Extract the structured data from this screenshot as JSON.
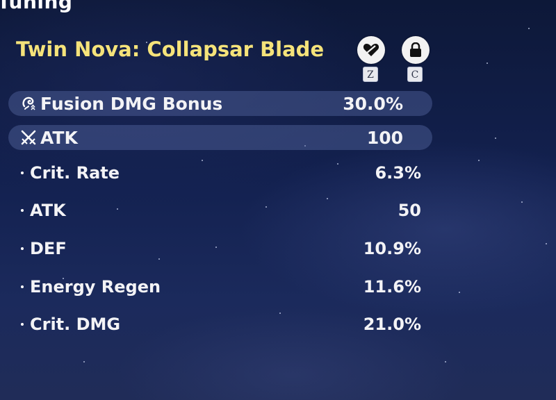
{
  "header": {
    "title": "Tuning"
  },
  "weapon": {
    "name": "Twin Nova: Collapsar Blade"
  },
  "actions": {
    "favorite": {
      "icon": "heart-slash-icon",
      "key": "Z"
    },
    "lock": {
      "icon": "lock-icon",
      "key": "C"
    }
  },
  "main_stats": [
    {
      "icon": "fusion-icon",
      "label": "Fusion DMG Bonus",
      "value": "30.0%"
    },
    {
      "icon": "crossed-swords-icon",
      "label": "ATK",
      "value": "100"
    }
  ],
  "sub_stats": [
    {
      "label": "Crit. Rate",
      "value": "6.3%"
    },
    {
      "label": "ATK",
      "value": "50"
    },
    {
      "label": "DEF",
      "value": "10.9%"
    },
    {
      "label": "Energy Regen",
      "value": "11.6%"
    },
    {
      "label": "Crit. DMG",
      "value": "21.0%"
    }
  ],
  "colors": {
    "weapon_name": "#f5e37a",
    "main_stat_bg": "#5567a0",
    "text": "#f3f3f6"
  }
}
